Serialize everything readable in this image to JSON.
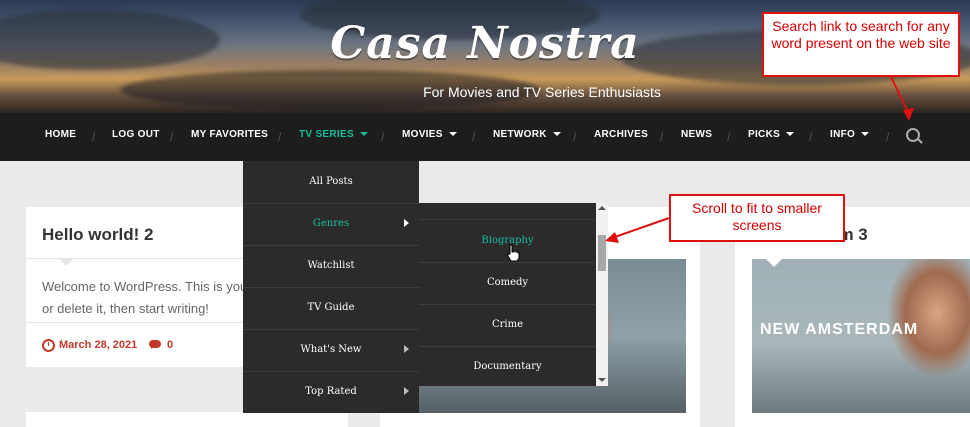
{
  "site": {
    "title": "Casa Nostra",
    "tagline": "For Movies and TV Series Enthusiasts"
  },
  "nav": {
    "items": [
      {
        "label": "HOME"
      },
      {
        "label": "LOG OUT"
      },
      {
        "label": "MY FAVORITES"
      },
      {
        "label": "TV SERIES"
      },
      {
        "label": "MOVIES"
      },
      {
        "label": "NETWORK"
      },
      {
        "label": "ARCHIVES"
      },
      {
        "label": "NEWS"
      },
      {
        "label": "PICKS"
      },
      {
        "label": "INFO"
      }
    ],
    "separator": "/",
    "search_icon": "search-icon"
  },
  "dropdown": {
    "items": [
      {
        "label": "All Posts"
      },
      {
        "label": "Genres"
      },
      {
        "label": "Watchlist"
      },
      {
        "label": "TV Guide"
      },
      {
        "label": "What's New"
      },
      {
        "label": "Top Rated"
      }
    ]
  },
  "submenu": {
    "items": [
      {
        "label": "Biography"
      },
      {
        "label": "Comedy"
      },
      {
        "label": "Crime"
      },
      {
        "label": "Documentary"
      }
    ]
  },
  "posts": [
    {
      "title": "Hello world! 2",
      "excerpt_line1": "Welcome to WordPress. This is your",
      "excerpt_line2": "or delete it, then start writing!",
      "date": "March 28, 2021",
      "comments": "0"
    },
    {
      "title": "rdam 3",
      "image_text": "NEW AMSTERDAM"
    }
  ],
  "annotations": {
    "search": "Search link to search for any word present on the web site",
    "scroll": "Scroll to fit to smaller screens"
  },
  "colors": {
    "nav_bg": "#1d1d1d",
    "accent": "#1abc9c",
    "meta": "#c0392b",
    "callout_border": "#e01010",
    "callout_text": "#d40000"
  }
}
